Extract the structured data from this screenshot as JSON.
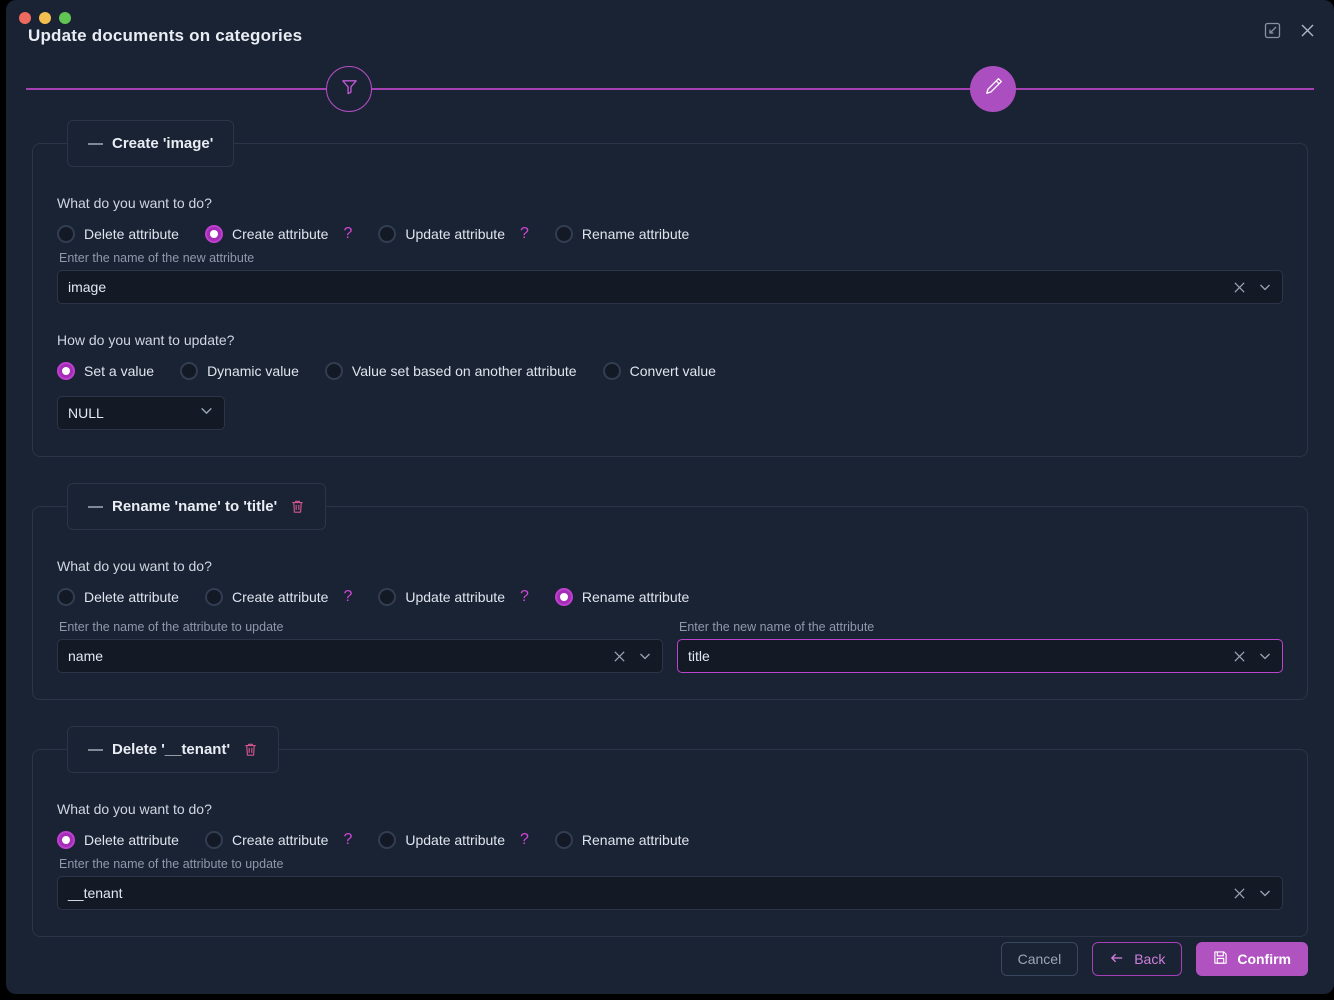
{
  "window": {
    "title": "Update documents on categories",
    "minimize_icon": "collapse-icon",
    "close_icon": "close-icon",
    "accent": "#b04ec2",
    "background": "#1a2333"
  },
  "stepper": {
    "steps": [
      {
        "name": "filter-step",
        "icon": "filter-icon",
        "state": "inactive"
      },
      {
        "name": "edit-step",
        "icon": "pencil-icon",
        "state": "active"
      }
    ]
  },
  "cards": [
    {
      "legend": "Create 'image'",
      "dash": "—",
      "has_delete": false,
      "action_question": "What do you want to do?",
      "action_options": [
        {
          "label": "Delete attribute",
          "selected": false,
          "help": false
        },
        {
          "label": "Create attribute",
          "selected": true,
          "help": true,
          "help_glyph": "?"
        },
        {
          "label": "Update attribute",
          "selected": false,
          "help": true,
          "help_glyph": "?"
        },
        {
          "label": "Rename attribute",
          "selected": false,
          "help": false
        }
      ],
      "primary_field": {
        "label": "Enter the name of the new attribute",
        "value": "image",
        "placeholder": "",
        "focused": false,
        "clear_icon": "clear-icon",
        "chevron_icon": "chevron-down-icon"
      },
      "update_question": "How do you want to update?",
      "update_options": [
        {
          "label": "Set a value",
          "selected": true
        },
        {
          "label": "Dynamic value",
          "selected": false
        },
        {
          "label": "Value set based on another attribute",
          "selected": false
        },
        {
          "label": "Convert value",
          "selected": false
        }
      ],
      "value_select": {
        "value": "NULL",
        "chevron_icon": "chevron-down-icon"
      }
    },
    {
      "legend": "Rename 'name' to 'title'",
      "dash": "—",
      "has_delete": true,
      "delete_icon": "trash-icon",
      "action_question": "What do you want to do?",
      "action_options": [
        {
          "label": "Delete attribute",
          "selected": false,
          "help": false
        },
        {
          "label": "Create attribute",
          "selected": false,
          "help": true,
          "help_glyph": "?"
        },
        {
          "label": "Update attribute",
          "selected": false,
          "help": true,
          "help_glyph": "?"
        },
        {
          "label": "Rename attribute",
          "selected": true,
          "help": false
        }
      ],
      "primary_field": {
        "label": "Enter the name of the attribute to update",
        "value": "name",
        "placeholder": "",
        "focused": false,
        "clear_icon": "clear-icon",
        "chevron_icon": "chevron-down-icon"
      },
      "secondary_field": {
        "label": "Enter the new name of the attribute",
        "value": "title",
        "placeholder": "",
        "focused": true,
        "clear_icon": "clear-icon",
        "chevron_icon": "chevron-down-icon"
      }
    },
    {
      "legend": "Delete '__tenant'",
      "dash": "—",
      "has_delete": true,
      "delete_icon": "trash-icon",
      "action_question": "What do you want to do?",
      "action_options": [
        {
          "label": "Delete attribute",
          "selected": true,
          "help": false
        },
        {
          "label": "Create attribute",
          "selected": false,
          "help": true,
          "help_glyph": "?"
        },
        {
          "label": "Update attribute",
          "selected": false,
          "help": true,
          "help_glyph": "?"
        },
        {
          "label": "Rename attribute",
          "selected": false,
          "help": false
        }
      ],
      "primary_field": {
        "label": "Enter the name of the attribute to update",
        "value": "__tenant",
        "placeholder": "",
        "focused": false,
        "clear_icon": "clear-icon",
        "chevron_icon": "chevron-down-icon"
      }
    }
  ],
  "footer": {
    "cancel_label": "Cancel",
    "back_label": "Back",
    "back_icon": "arrow-left-icon",
    "confirm_label": "Confirm",
    "confirm_icon": "save-icon"
  }
}
